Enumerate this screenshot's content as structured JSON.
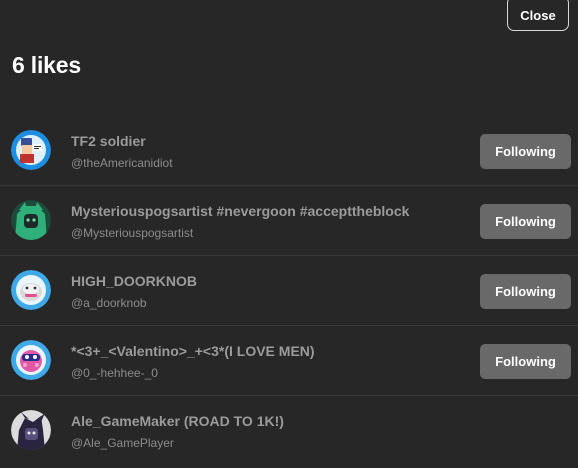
{
  "header": {
    "close_label": "Close",
    "title": "6 likes"
  },
  "users": [
    {
      "name": "TF2 soldier",
      "handle": "@theAmericanidiot",
      "button": "Following",
      "avatar_icon": "tf2-soldier-avatar"
    },
    {
      "name": "Mysteriouspogsartist #nevergoon #accepttheblock",
      "handle": "@Mysteriouspogsartist",
      "button": "Following",
      "avatar_icon": "green-character-avatar"
    },
    {
      "name": "HIGH_DOORKNOB",
      "handle": "@a_doorknob",
      "button": "Following",
      "avatar_icon": "doorknob-avatar"
    },
    {
      "name": "*<3+_<Valentino>_+<3*(I LOVE MEN)",
      "handle": "@0_-hehhee-_0",
      "button": "Following",
      "avatar_icon": "pink-character-avatar"
    },
    {
      "name": "Ale_GameMaker (ROAD TO 1K!)",
      "handle": "@Ale_GamePlayer",
      "avatar_icon": "dark-character-avatar"
    }
  ],
  "colors": {
    "background": "#272727",
    "button": "#696969",
    "name_text": "#9b9b9b",
    "handle_text": "#8c8c8c"
  }
}
